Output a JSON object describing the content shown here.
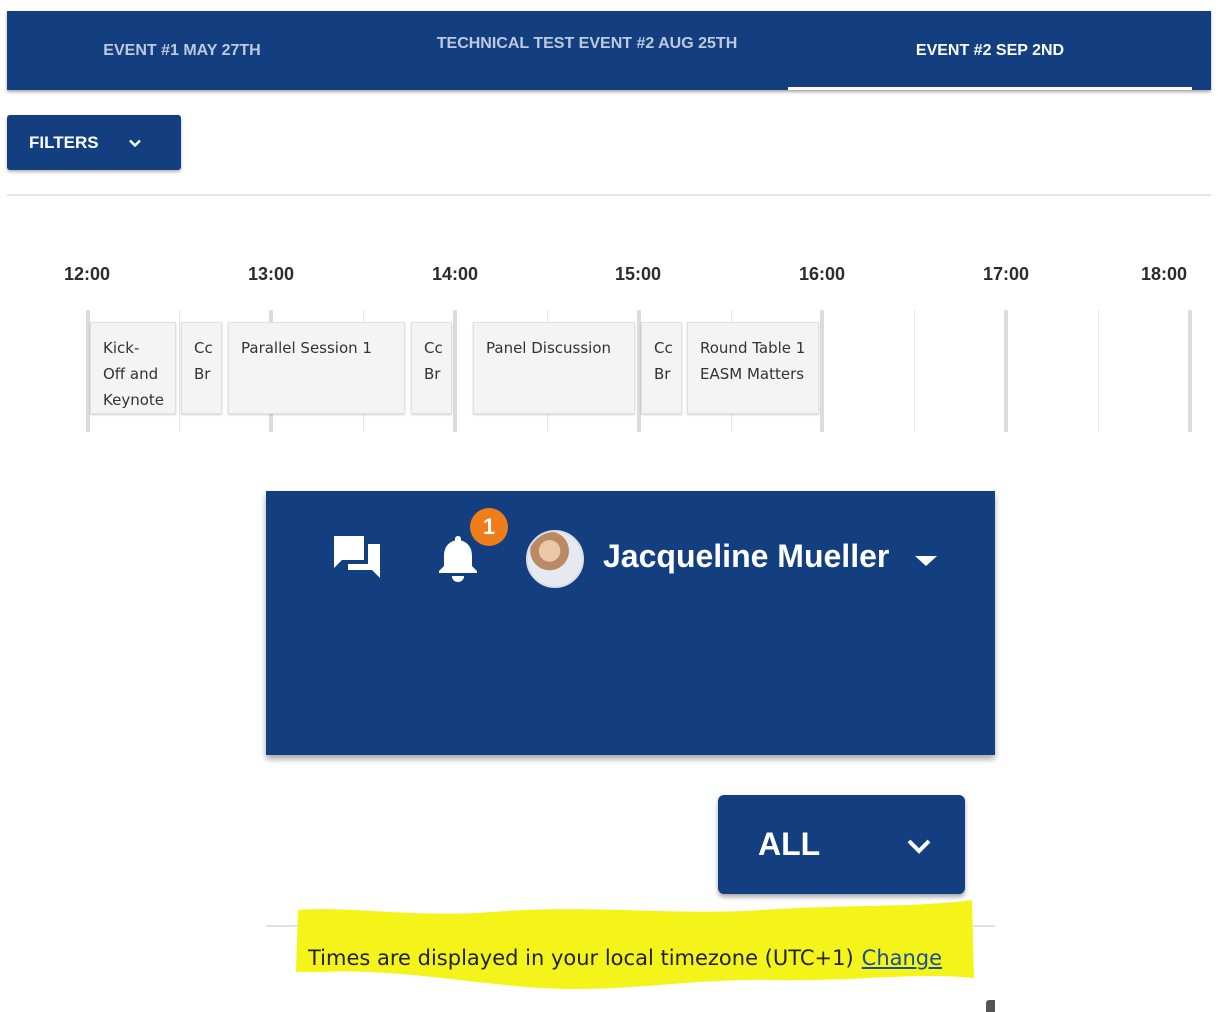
{
  "tabs": [
    {
      "label": "EVENT #1 MAY 27TH",
      "active": false
    },
    {
      "label": "TECHNICAL TEST EVENT #2 AUG 25TH",
      "active": false
    },
    {
      "label": "EVENT #2 SEP 2ND",
      "active": true
    }
  ],
  "filters": {
    "label": "FILTERS",
    "icon": "chevron-down-icon"
  },
  "timeline": {
    "hours": [
      "12:00",
      "13:00",
      "14:00",
      "15:00",
      "16:00",
      "17:00",
      "18:00"
    ],
    "sessions": [
      {
        "title": "Kick-Off and Keynote",
        "lines": [
          "Kick-",
          "Off and",
          "Keynote"
        ]
      },
      {
        "title": "Coffee Break",
        "lines": [
          "Cc",
          "Br"
        ]
      },
      {
        "title": "Parallel Session 1",
        "lines": [
          "Parallel Session 1"
        ]
      },
      {
        "title": "Coffee Break",
        "lines": [
          "Cc",
          "Br"
        ]
      },
      {
        "title": "Panel Discussion",
        "lines": [
          "Panel Discussion"
        ]
      },
      {
        "title": "Coffee Break",
        "lines": [
          "Cc",
          "Br"
        ]
      },
      {
        "title": "Round Table 1 EASM Matters",
        "lines": [
          "Round Table 1",
          "EASM Matters"
        ]
      }
    ]
  },
  "header": {
    "chat_icon": "chat-icon",
    "bell_icon": "bell-icon",
    "notification_count": "1",
    "user_name": "Jacqueline Mueller",
    "colors": {
      "primary": "#133f80",
      "badge": "#ef7d1a",
      "highlight": "#f4f41a"
    }
  },
  "group_filter": {
    "label": "ALL",
    "icon": "chevron-down-icon"
  },
  "timezone": {
    "note": "Times are displayed in your local timezone (UTC+1)",
    "change_label": "Change"
  }
}
